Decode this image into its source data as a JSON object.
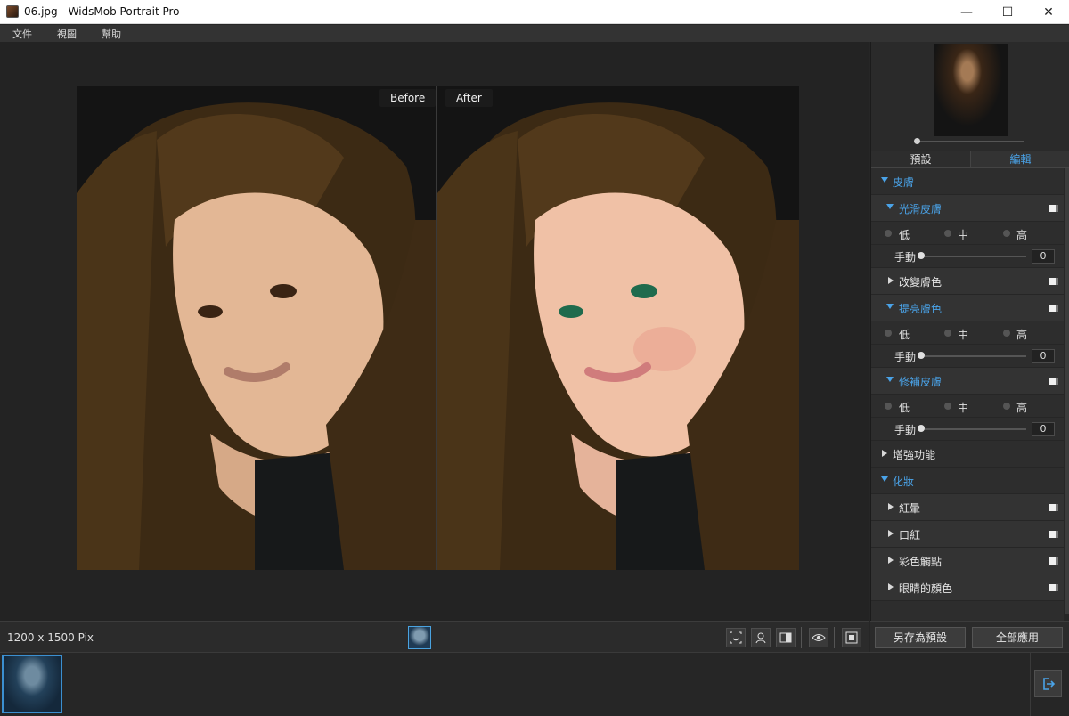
{
  "window": {
    "title": "06.jpg - WidsMob Portrait Pro",
    "minimize": "—",
    "maximize": "☐",
    "close": "✕"
  },
  "menu": {
    "items": [
      "文件",
      "視圖",
      "幫助"
    ]
  },
  "viewer": {
    "before_label": "Before",
    "after_label": "After"
  },
  "status": {
    "dimensions": "1200 x 1500 Pix"
  },
  "panel": {
    "tabs": [
      "預設",
      "編輯"
    ],
    "active_tab": "編輯",
    "options": {
      "low": "低",
      "mid": "中",
      "high": "高",
      "manual": "手動"
    },
    "skin": {
      "title": "皮膚",
      "smooth": {
        "title": "光滑皮膚",
        "value": "0"
      },
      "change_color": {
        "title": "改變膚色"
      },
      "brighten": {
        "title": "提亮膚色",
        "value": "0"
      },
      "repair": {
        "title": "修補皮膚",
        "value": "0"
      },
      "enhance": {
        "title": "增強功能"
      }
    },
    "makeup": {
      "title": "化妝",
      "blush": "紅暈",
      "lipstick": "口紅",
      "color_dots": "彩色觸點",
      "eye_color": "眼睛的顏色"
    },
    "buttons": {
      "save_preset": "另存為預設",
      "apply_all": "全部應用"
    }
  },
  "colors": {
    "accent": "#4aa3e8",
    "background": "#262626",
    "panel": "#2d2d2d"
  }
}
